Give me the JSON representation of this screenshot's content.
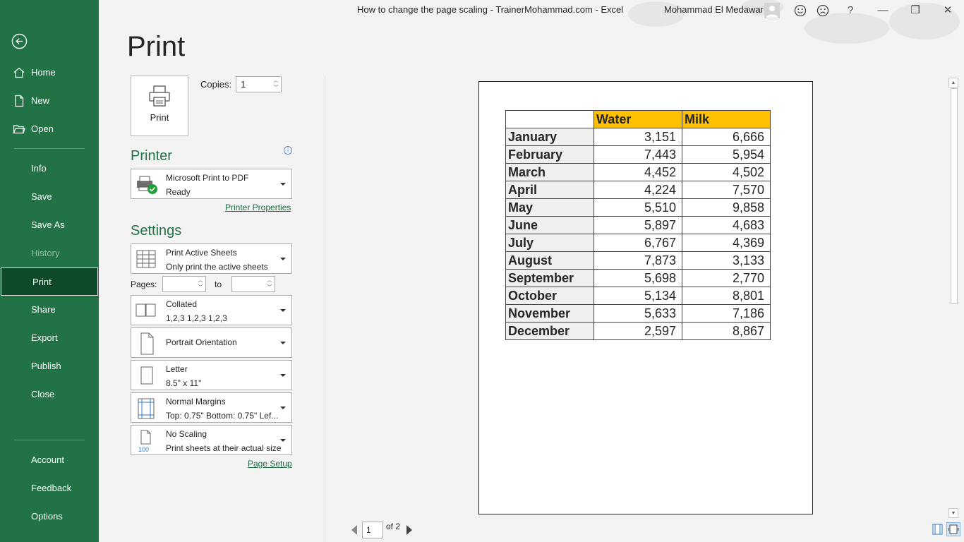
{
  "window": {
    "title": "How to change the page scaling - TrainerMohammad.com  -  Excel",
    "user": "Mohammad El Medawar",
    "help": "?",
    "minimize": "—",
    "restore": "❐",
    "close": "✕"
  },
  "nav": {
    "items": [
      {
        "label": "Home",
        "icon": "home-icon"
      },
      {
        "label": "New",
        "icon": "new-file-icon"
      },
      {
        "label": "Open",
        "icon": "open-folder-icon"
      },
      {
        "label": "Info"
      },
      {
        "label": "Save"
      },
      {
        "label": "Save As"
      },
      {
        "label": "History",
        "disabled": true
      },
      {
        "label": "Print",
        "active": true
      },
      {
        "label": "Share"
      },
      {
        "label": "Export"
      },
      {
        "label": "Publish"
      },
      {
        "label": "Close"
      },
      {
        "label": "Account"
      },
      {
        "label": "Feedback"
      },
      {
        "label": "Options"
      }
    ]
  },
  "page": {
    "title": "Print"
  },
  "print": {
    "button_label": "Print",
    "copies_label": "Copies:",
    "copies_value": "1"
  },
  "printer": {
    "heading": "Printer",
    "name": "Microsoft Print to PDF",
    "status": "Ready",
    "properties_link": "Printer Properties"
  },
  "settings": {
    "heading": "Settings",
    "sheets": {
      "line1": "Print Active Sheets",
      "line2": "Only print the active sheets"
    },
    "pages_label": "Pages:",
    "to_label": "to",
    "collate": {
      "line1": "Collated",
      "line2": "1,2,3    1,2,3    1,2,3"
    },
    "orientation": "Portrait Orientation",
    "paper": {
      "line1": "Letter",
      "line2": "8.5\" x 11\""
    },
    "margins": {
      "line1": "Normal Margins",
      "line2": "Top: 0.75\" Bottom: 0.75\" Lef..."
    },
    "scaling": {
      "line1": "No Scaling",
      "line2": "Print sheets at their actual size",
      "icon_text": "100"
    },
    "page_setup_link": "Page Setup"
  },
  "preview": {
    "headers": [
      "",
      "Water",
      "Milk"
    ],
    "rows": [
      [
        "January",
        "3,151",
        "6,666"
      ],
      [
        "February",
        "7,443",
        "5,954"
      ],
      [
        "March",
        "4,452",
        "4,502"
      ],
      [
        "April",
        "4,224",
        "7,570"
      ],
      [
        "May",
        "5,510",
        "9,858"
      ],
      [
        "June",
        "5,897",
        "4,683"
      ],
      [
        "July",
        "6,767",
        "4,369"
      ],
      [
        "August",
        "7,873",
        "3,133"
      ],
      [
        "September",
        "5,698",
        "2,770"
      ],
      [
        "October",
        "5,134",
        "8,801"
      ],
      [
        "November",
        "5,633",
        "7,186"
      ],
      [
        "December",
        "2,597",
        "8,867"
      ]
    ],
    "header_fill": "#ffc000",
    "current_page": "1",
    "of_pages": "of 2"
  },
  "colors": {
    "accent": "#217346",
    "nav_active": "#0e4a29"
  }
}
